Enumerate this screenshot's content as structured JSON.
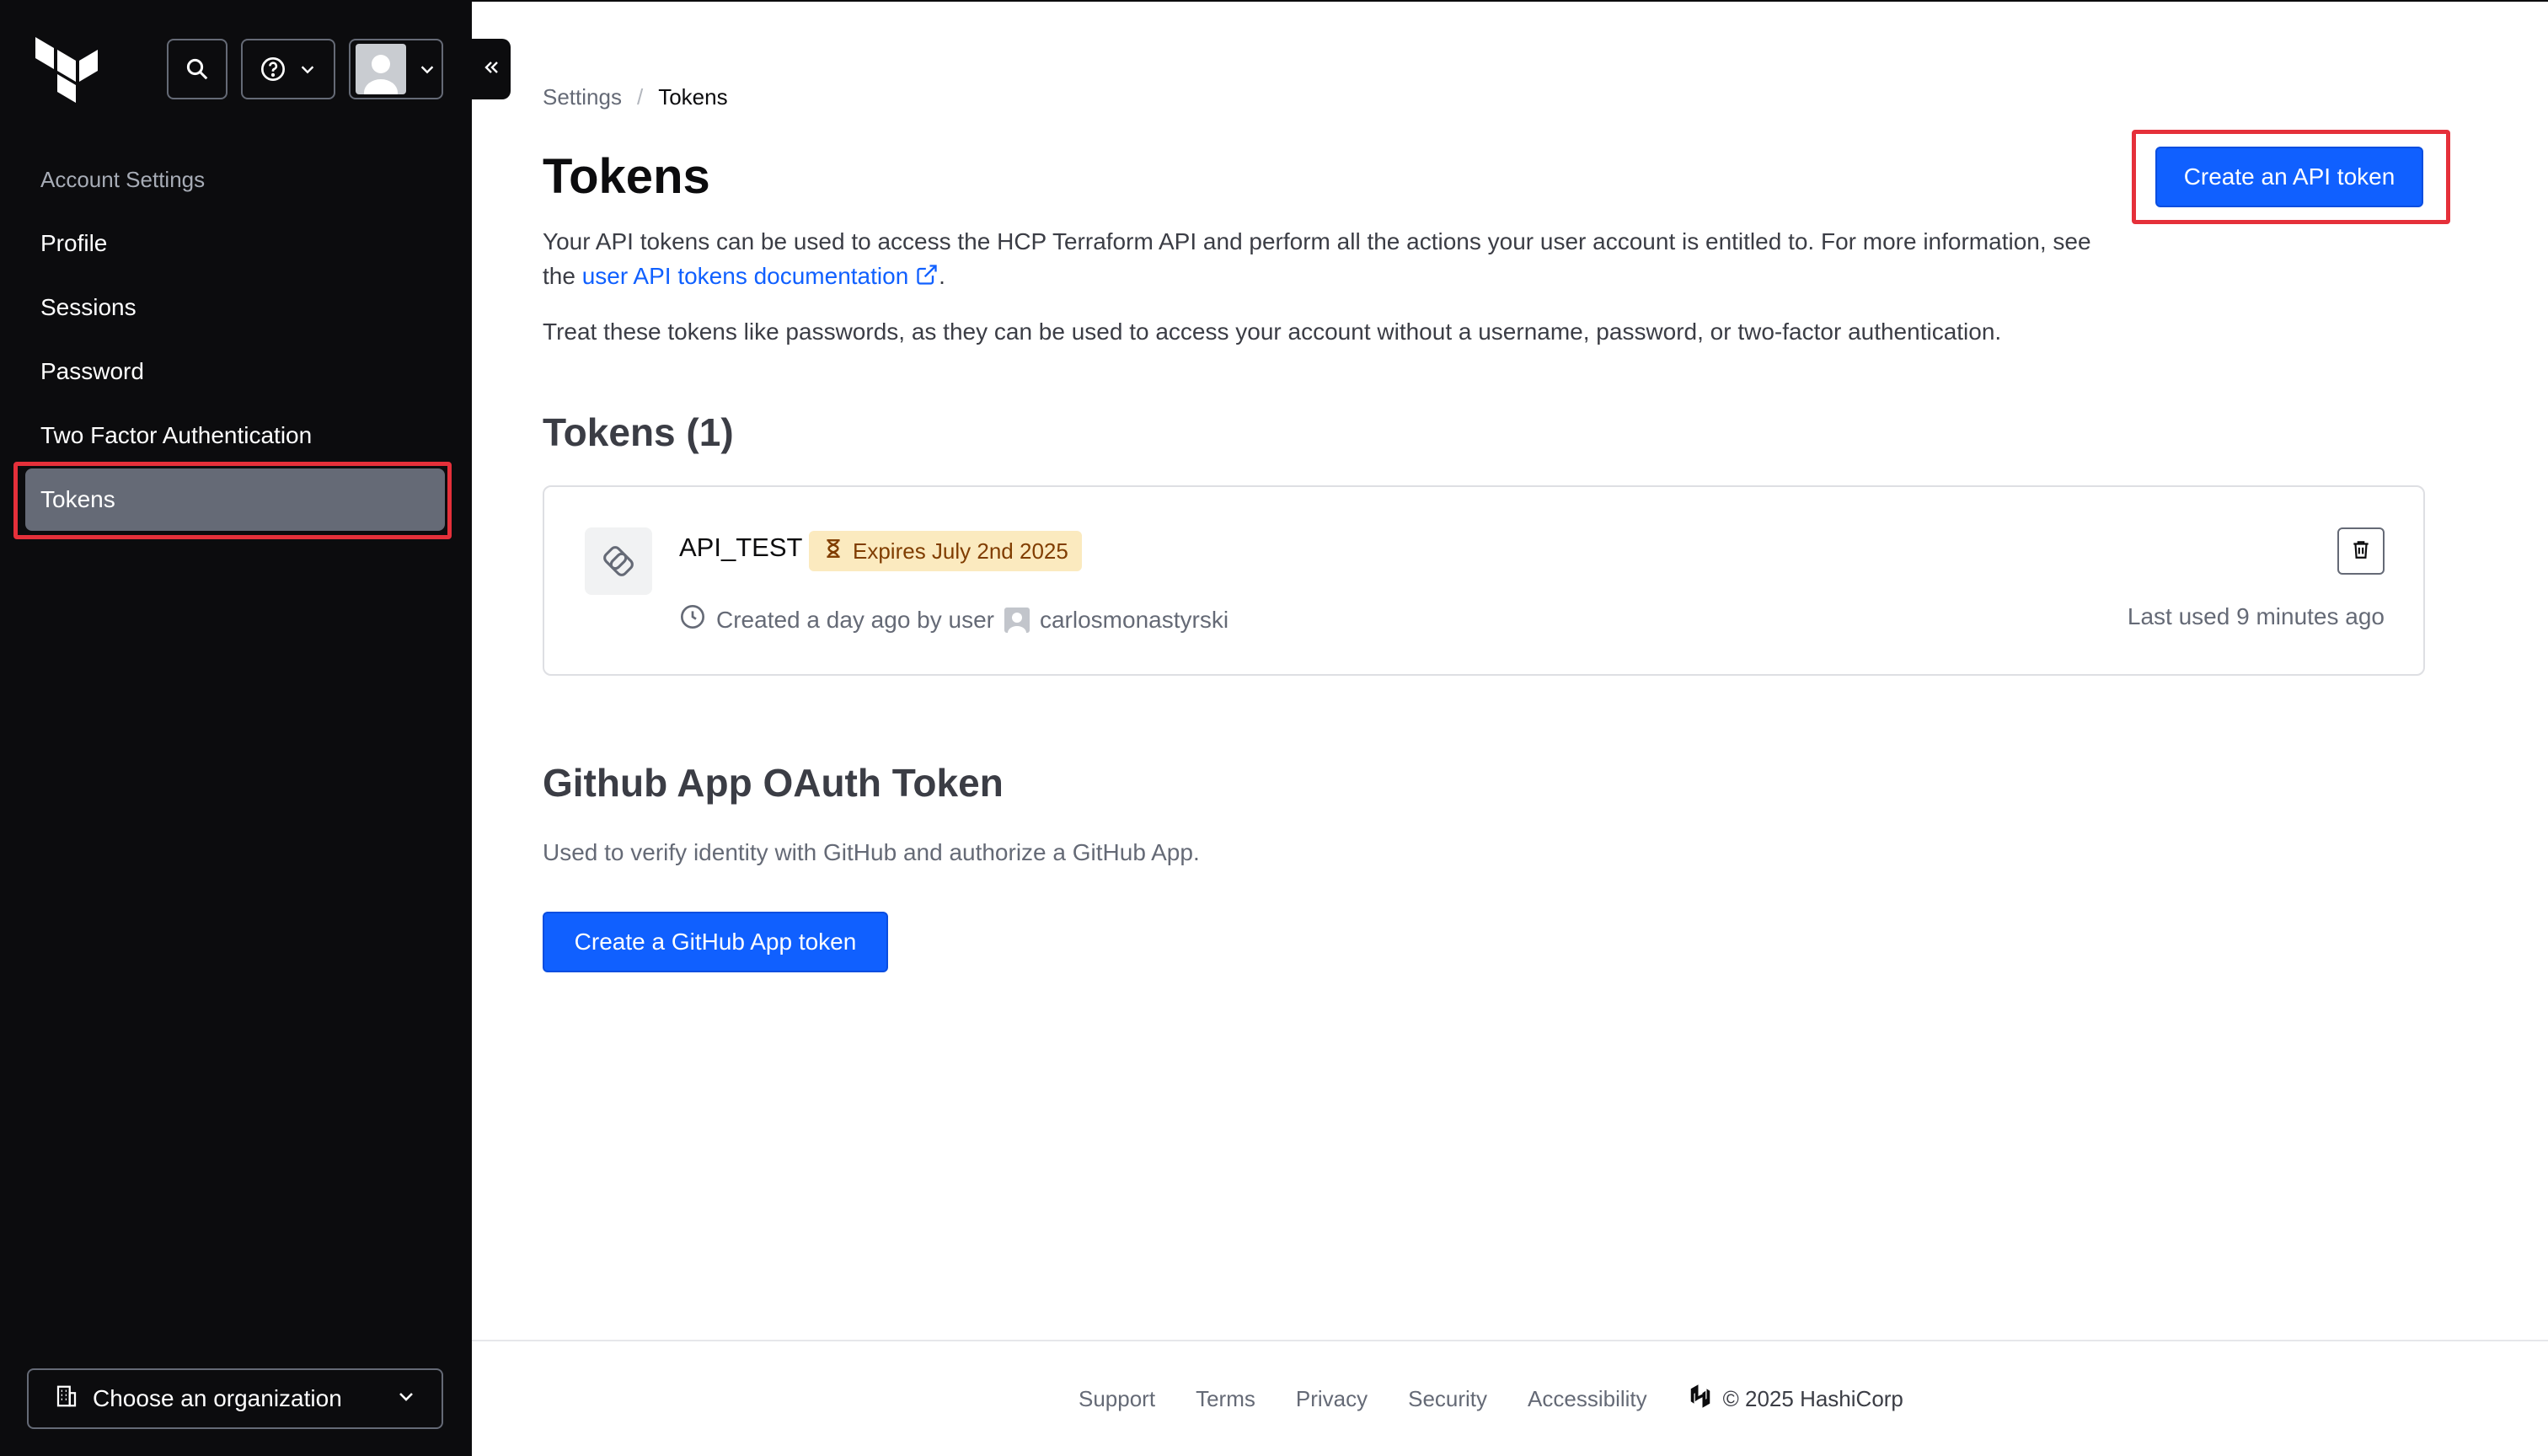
{
  "sidebar": {
    "heading": "Account Settings",
    "items": [
      {
        "label": "Profile"
      },
      {
        "label": "Sessions"
      },
      {
        "label": "Password"
      },
      {
        "label": "Two Factor Authentication"
      },
      {
        "label": "Tokens"
      }
    ],
    "org_select": "Choose an organization"
  },
  "breadcrumb": {
    "parent": "Settings",
    "separator": "/",
    "current": "Tokens"
  },
  "page": {
    "title": "Tokens",
    "desc_part1": "Your API tokens can be used to access the HCP Terraform API and perform all the actions your user account is entitled to. For more information, see the ",
    "desc_link": "user API tokens documentation",
    "desc_part2": ".",
    "desc2": "Treat these tokens like passwords, as they can be used to access your account without a username, password, or two-factor authentication.",
    "create_api_token": "Create an API token"
  },
  "tokens": {
    "title": "Tokens (1)",
    "items": [
      {
        "name": "API_TEST",
        "badge": "Expires July 2nd 2025",
        "created": "Created a day ago by user",
        "user": "carlosmonastyrski",
        "last_used": "Last used 9 minutes ago"
      }
    ]
  },
  "github": {
    "title": "Github App OAuth Token",
    "desc": "Used to verify identity with GitHub and authorize a GitHub App.",
    "button": "Create a GitHub App token"
  },
  "footer": {
    "links": [
      "Support",
      "Terms",
      "Privacy",
      "Security",
      "Accessibility"
    ],
    "copyright": "© 2025 HashiCorp"
  },
  "colors": {
    "sidebar_bg": "#0c0c0e",
    "primary": "#1060ff",
    "highlight": "#e5303a",
    "badge_bg": "#fbeabf"
  }
}
